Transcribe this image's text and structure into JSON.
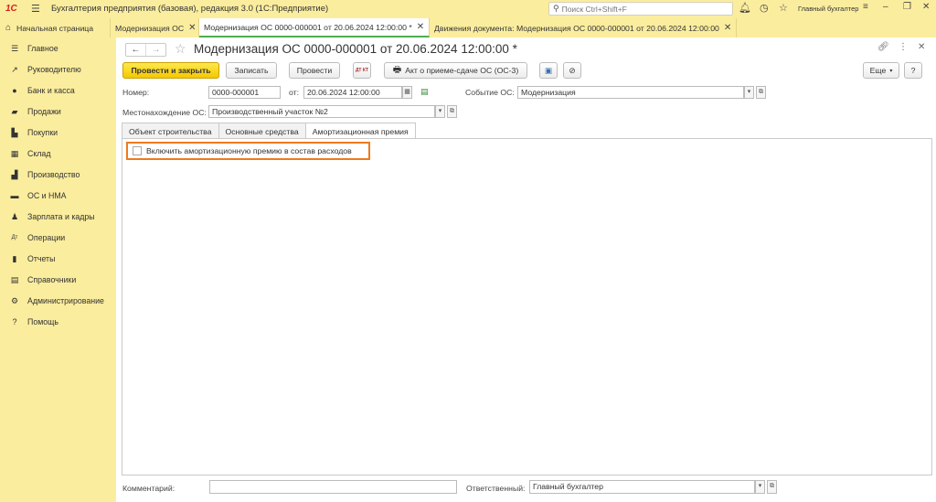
{
  "titlebar": {
    "logo": "1С",
    "app_title": "Бухгалтерия предприятия (базовая), редакция 3.0  (1С:Предприятие)",
    "search_placeholder": "Поиск Ctrl+Shift+F",
    "user": "Главный бухгалтер"
  },
  "tabs": [
    {
      "label": "Начальная страница"
    },
    {
      "label": "Модернизация ОС"
    },
    {
      "label": "Модернизация ОС 0000-000001 от 20.06.2024 12:00:00 *"
    },
    {
      "label": "Движения документа: Модернизация ОС 0000-000001 от 20.06.2024 12:00:00"
    }
  ],
  "sidebar": {
    "items": [
      {
        "label": "Главное",
        "icon": "menu-icon"
      },
      {
        "label": "Руководителю",
        "icon": "trend-icon"
      },
      {
        "label": "Банк и касса",
        "icon": "coin-icon"
      },
      {
        "label": "Продажи",
        "icon": "bag-icon"
      },
      {
        "label": "Покупки",
        "icon": "cart-icon"
      },
      {
        "label": "Склад",
        "icon": "warehouse-icon"
      },
      {
        "label": "Производство",
        "icon": "factory-icon"
      },
      {
        "label": "ОС и НМА",
        "icon": "truck-icon"
      },
      {
        "label": "Зарплата и кадры",
        "icon": "person-icon"
      },
      {
        "label": "Операции",
        "icon": "dt-kt-icon"
      },
      {
        "label": "Отчеты",
        "icon": "report-icon"
      },
      {
        "label": "Справочники",
        "icon": "book-icon"
      },
      {
        "label": "Администрирование",
        "icon": "gear-icon"
      },
      {
        "label": "Помощь",
        "icon": "help-icon"
      }
    ]
  },
  "document": {
    "title": "Модернизация ОС 0000-000001 от 20.06.2024 12:00:00 *",
    "toolbar": {
      "post_close": "Провести и закрыть",
      "save": "Записать",
      "post": "Провести",
      "dt_kt": "ДТ КТ",
      "act": "Акт о приеме-сдаче ОС (ОС-3)",
      "more": "Еще",
      "help": "?"
    },
    "number_label": "Номер:",
    "number_value": "0000-000001",
    "date_label": "от:",
    "date_value": "20.06.2024 12:00:00",
    "event_label": "Событие ОС:",
    "event_value": "Модернизация",
    "location_label": "Местонахождение ОС:",
    "location_value": "Производственный участок №2",
    "form_tabs": [
      "Объект строительства",
      "Основные средства",
      "Амортизационная премия"
    ],
    "checkbox_label": "Включить амортизационную премию в состав расходов",
    "comment_label": "Комментарий:",
    "comment_value": "",
    "responsible_label": "Ответственный:",
    "responsible_value": "Главный бухгалтер"
  },
  "colors": {
    "panel": "#fbed9e",
    "primary_button": "#f5c800",
    "highlight": "#f07a1a",
    "active_tab_underline": "#4caf50"
  }
}
